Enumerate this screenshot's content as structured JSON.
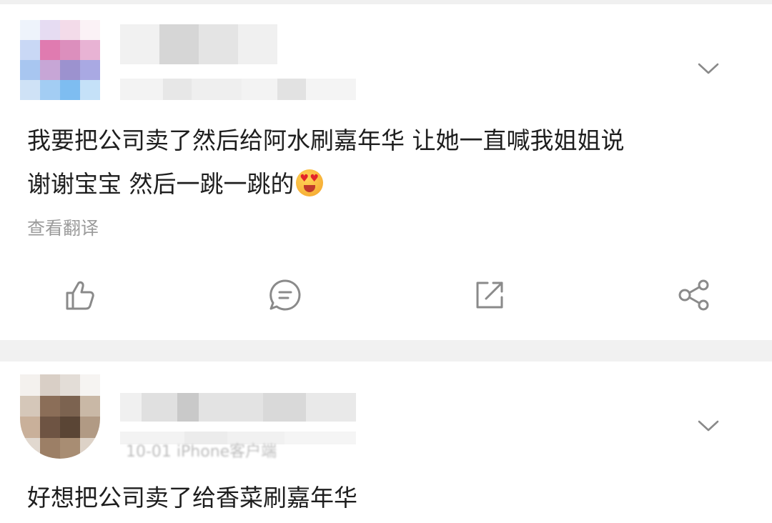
{
  "feed": {
    "comments": [
      {
        "text_line1": "我要把公司卖了然后给阿水刷嘉年华 让她一直喊我姐姐说",
        "text_line2": "谢谢宝宝 然后一跳一跳的",
        "emoji": "heart-eyes-tongue-emoji",
        "translate_label": "查看翻译"
      },
      {
        "meta_partial": "10-01 iPhone客户端",
        "text_line1": "好想把公司卖了给香菜刷嘉年华"
      }
    ],
    "actions": [
      "like-icon",
      "comment-icon",
      "repost-icon",
      "share-icon"
    ]
  },
  "colors": {
    "background": "#ffffff",
    "divider": "#f1f1f1",
    "text": "#1e1e1e",
    "secondary_text": "#9b9b9b",
    "icon": "#8a8a8a"
  }
}
